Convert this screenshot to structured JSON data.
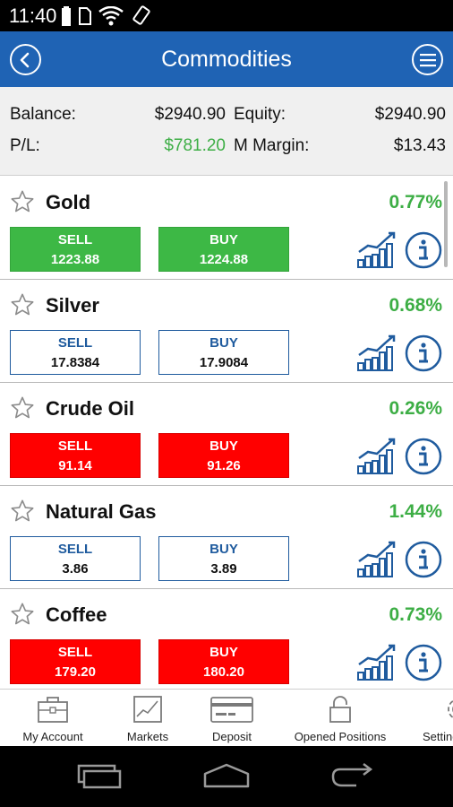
{
  "status_bar": {
    "time": "11:40"
  },
  "header": {
    "title": "Commodities"
  },
  "account": {
    "balance_label": "Balance:",
    "balance_value": "$2940.90",
    "equity_label": "Equity:",
    "equity_value": "$2940.90",
    "pl_label": "P/L:",
    "pl_value": "$781.20",
    "margin_label": "M Margin:",
    "margin_value": "$13.43"
  },
  "instruments": [
    {
      "name": "Gold",
      "change": "0.77%",
      "sell_label": "SELL",
      "sell_price": "1223.88",
      "buy_label": "BUY",
      "buy_price": "1224.88",
      "button_state": "green"
    },
    {
      "name": "Silver",
      "change": "0.68%",
      "sell_label": "SELL",
      "sell_price": "17.8384",
      "buy_label": "BUY",
      "buy_price": "17.9084",
      "button_state": "neutral"
    },
    {
      "name": "Crude Oil",
      "change": "0.26%",
      "sell_label": "SELL",
      "sell_price": "91.14",
      "buy_label": "BUY",
      "buy_price": "91.26",
      "button_state": "red"
    },
    {
      "name": "Natural Gas",
      "change": "1.44%",
      "sell_label": "SELL",
      "sell_price": "3.86",
      "buy_label": "BUY",
      "buy_price": "3.89",
      "button_state": "neutral"
    },
    {
      "name": "Coffee",
      "change": "0.73%",
      "sell_label": "SELL",
      "sell_price": "179.20",
      "buy_label": "BUY",
      "buy_price": "180.20",
      "button_state": "red"
    }
  ],
  "bottom_nav": {
    "my_account": "My Account",
    "markets": "Markets",
    "deposit": "Deposit",
    "opened_positions": "Opened Positions",
    "settings": "Settings"
  },
  "colors": {
    "header_blue": "#1f63b4",
    "positive_green": "#3dae45",
    "buy_green": "#3db845",
    "sell_red": "#ff0000",
    "outline_blue": "#1f5b9e"
  },
  "icons": [
    "back-icon",
    "menu-icon",
    "star-icon",
    "chart-icon",
    "info-icon",
    "briefcase-icon",
    "markets-icon",
    "card-icon",
    "lock-icon",
    "gear-icon"
  ]
}
